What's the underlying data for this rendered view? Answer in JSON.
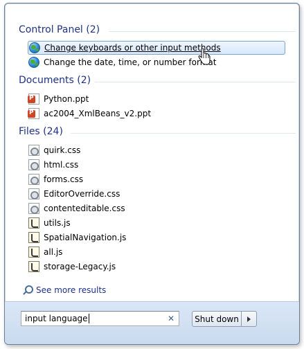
{
  "groups": {
    "control_panel": {
      "header": "Control Panel (2)",
      "items": [
        {
          "label": "Change keyboards or other input methods",
          "icon": "globe-icon"
        },
        {
          "label": "Change the date, time, or number format",
          "icon": "globe-icon"
        }
      ]
    },
    "documents": {
      "header": "Documents (2)",
      "items": [
        {
          "label": "Python.ppt",
          "icon": "powerpoint-icon"
        },
        {
          "label": "ac2004_XmlBeans_v2.ppt",
          "icon": "powerpoint-icon"
        }
      ]
    },
    "files": {
      "header": "Files (24)",
      "items": [
        {
          "label": "quirk.css",
          "icon": "css-file-icon"
        },
        {
          "label": "html.css",
          "icon": "css-file-icon"
        },
        {
          "label": "forms.css",
          "icon": "css-file-icon"
        },
        {
          "label": "EditorOverride.css",
          "icon": "css-file-icon"
        },
        {
          "label": "contenteditable.css",
          "icon": "css-file-icon"
        },
        {
          "label": "utils.js",
          "icon": "js-file-icon"
        },
        {
          "label": "SpatialNavigation.js",
          "icon": "js-file-icon"
        },
        {
          "label": "all.js",
          "icon": "js-file-icon"
        },
        {
          "label": "storage-Legacy.js",
          "icon": "js-file-icon"
        }
      ]
    }
  },
  "see_more": "See more results",
  "search": {
    "value": "input language",
    "clear_icon": "close-icon"
  },
  "shutdown": {
    "label": "Shut down",
    "arrow_icon": "arrow-right-icon"
  },
  "colors": {
    "header_text": "#1e3287",
    "highlight_border": "#7da2ce",
    "bottom_bar": "#d3e1f3"
  }
}
